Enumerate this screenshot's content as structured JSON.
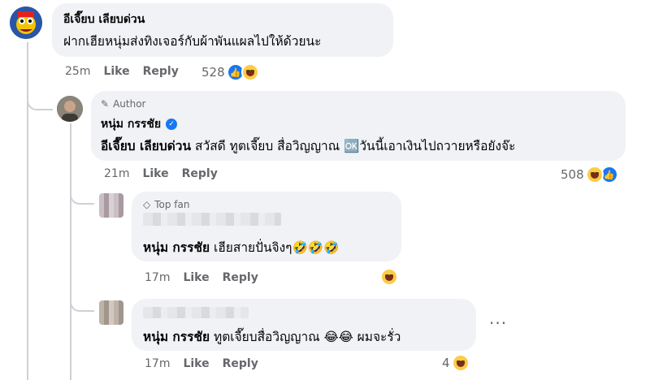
{
  "comment1": {
    "author": "อีเจี๊ยบ เลียบด่วน",
    "text": "ฝากเฮียหนุ่มส่งทิงเจอร์กับผ้าพันแผลไปให้ด้วยนะ",
    "time": "25m",
    "like_label": "Like",
    "reply_label": "Reply",
    "reaction_count": "528"
  },
  "reply1": {
    "badge": "Author",
    "author": "หนุ่ม กรรชัย",
    "mention": "อีเจี๊ยบ เลียบด่วน",
    "text": "สวัสดี ทูตเจี๊ยบ สื่อวิญญาณ 🆗วันนี้เอาเงินไปถวายหรือยังจ๊ะ",
    "time": "21m",
    "like_label": "Like",
    "reply_label": "Reply",
    "reaction_count": "508"
  },
  "reply2": {
    "badge": "Top fan",
    "mention": "หนุ่ม กรรชัย",
    "text": "เฮียสายปั่นจิงๆ🤣🤣🤣",
    "time": "17m",
    "like_label": "Like",
    "reply_label": "Reply"
  },
  "reply3": {
    "mention": "หนุ่ม กรรชัย",
    "text": "ทูตเจี๊ยบสื่อวิญญาณ 😂😂 ผมจะรั่ว",
    "time": "17m",
    "like_label": "Like",
    "reply_label": "Reply",
    "reaction_count": "4",
    "more": "···"
  },
  "colors": {
    "bubble": "#f0f2f5",
    "verified": "#1877f2",
    "meta": "#65676b"
  }
}
